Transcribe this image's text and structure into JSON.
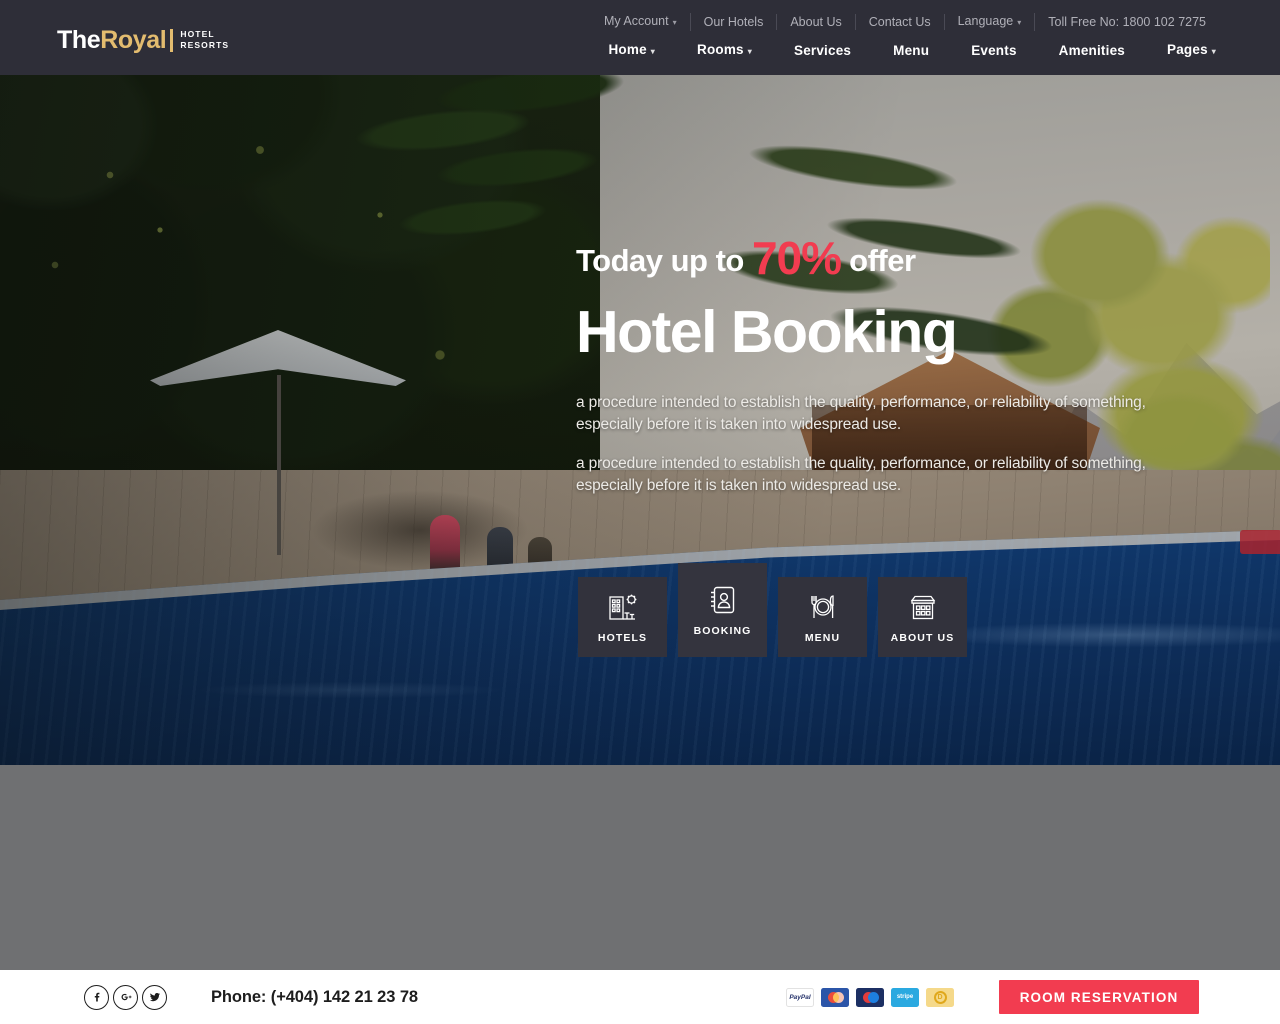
{
  "brand": {
    "name_part1": "The",
    "name_part2": "Royal",
    "sub_line1": "HOTEL",
    "sub_line2": "RESORTS",
    "gold": "#e3bc6f",
    "accent_red": "#f23c50"
  },
  "topnav": {
    "items": [
      {
        "label": "My Account",
        "has_caret": true
      },
      {
        "label": "Our Hotels",
        "has_caret": false
      },
      {
        "label": "About Us",
        "has_caret": false
      },
      {
        "label": "Contact Us",
        "has_caret": false
      },
      {
        "label": "Language",
        "has_caret": true
      },
      {
        "label": "Toll Free No: 1800 102 7275",
        "has_caret": false
      }
    ]
  },
  "mainnav": {
    "items": [
      {
        "label": "Home",
        "has_caret": true
      },
      {
        "label": "Rooms",
        "has_caret": true
      },
      {
        "label": "Services",
        "has_caret": false
      },
      {
        "label": "Menu",
        "has_caret": false
      },
      {
        "label": "Events",
        "has_caret": false
      },
      {
        "label": "Amenities",
        "has_caret": false
      },
      {
        "label": "Pages",
        "has_caret": true
      }
    ]
  },
  "hero": {
    "offer_prefix": "Today up to ",
    "offer_percent": "70%",
    "offer_suffix": " offer",
    "title": "Hotel Booking",
    "paragraph1": "a procedure intended to establish the quality, performance, or reliability of something, especially before it is taken into widespread use.",
    "paragraph2": "a procedure intended to establish the quality, performance, or reliability of something, especially before it is taken into widespread use.",
    "tiles": [
      {
        "label": "HOTELS",
        "icon": "hotel-building-icon",
        "active": false
      },
      {
        "label": "BOOKING",
        "icon": "contact-book-icon",
        "active": true
      },
      {
        "label": "MENU",
        "icon": "plate-cutlery-icon",
        "active": false
      },
      {
        "label": "ABOUT US",
        "icon": "hotel-facade-icon",
        "active": false
      }
    ]
  },
  "footer": {
    "social": [
      {
        "name": "facebook-icon",
        "label": "f"
      },
      {
        "name": "google-plus-icon",
        "label": "G+"
      },
      {
        "name": "twitter-icon",
        "label": "t"
      }
    ],
    "phone": "Phone: (+404) 142 21 23 78",
    "payments": [
      {
        "name": "paypal-icon",
        "label": "PayPal"
      },
      {
        "name": "mastercard-icon",
        "label": ""
      },
      {
        "name": "visa-card-icon",
        "label": ""
      },
      {
        "name": "stripe-icon",
        "label": "stripe"
      },
      {
        "name": "coin-icon",
        "label": "D"
      }
    ],
    "reserve_label": "ROOM RESERVATION"
  }
}
